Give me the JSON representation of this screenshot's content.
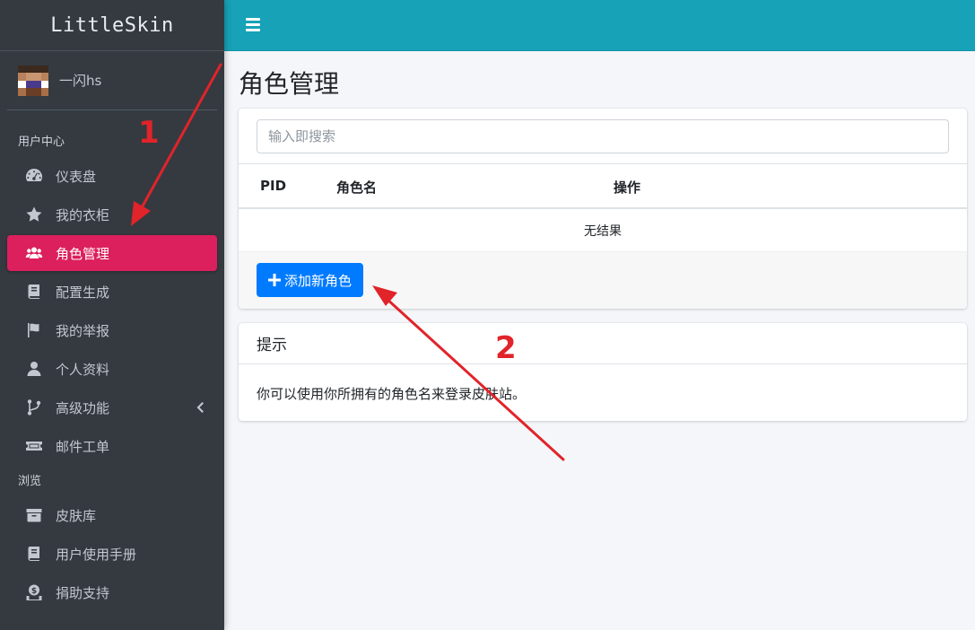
{
  "app": {
    "brand": "LittleSkin"
  },
  "user": {
    "name": "一闪hs"
  },
  "sidebar": {
    "section_user": "用户中心",
    "section_browse": "浏览",
    "items": [
      {
        "label": "仪表盘",
        "icon": "tachometer-icon"
      },
      {
        "label": "我的衣柜",
        "icon": "star-icon"
      },
      {
        "label": "角色管理",
        "icon": "users-icon",
        "active": true
      },
      {
        "label": "配置生成",
        "icon": "book-icon"
      },
      {
        "label": "我的举报",
        "icon": "flag-icon"
      },
      {
        "label": "个人资料",
        "icon": "user-icon"
      },
      {
        "label": "高级功能",
        "icon": "code-branch-icon",
        "has_submenu": true
      },
      {
        "label": "邮件工单",
        "icon": "ticket-icon"
      }
    ],
    "browse_items": [
      {
        "label": "皮肤库",
        "icon": "archive-icon"
      },
      {
        "label": "用户使用手册",
        "icon": "book-icon"
      },
      {
        "label": "捐助支持",
        "icon": "donate-icon"
      }
    ]
  },
  "main": {
    "title": "角色管理",
    "search": {
      "placeholder": "输入即搜索",
      "value": ""
    },
    "table": {
      "columns": [
        "PID",
        "角色名",
        "操作"
      ],
      "empty_text": "无结果"
    },
    "add_button": "添加新角色",
    "tip": {
      "title": "提示",
      "body": "你可以使用你所拥有的角色名来登录皮肤站。"
    }
  },
  "annotations": {
    "marker_1": "1",
    "marker_2": "2"
  },
  "colors": {
    "sidebar_bg": "#343a40",
    "topbar_bg": "#17a2b8",
    "active_item": "#dc1f5d",
    "primary_button": "#007bff",
    "annotation": "#e0242a"
  }
}
